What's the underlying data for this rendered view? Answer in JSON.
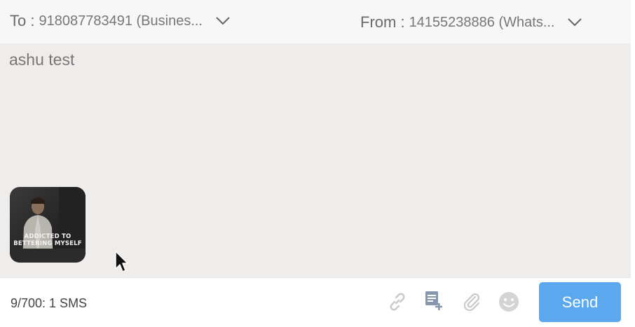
{
  "header": {
    "to_label": "To :",
    "to_value": "918087783491 (Busines...",
    "from_label": "From :",
    "from_value": "14155238886 (Whats..."
  },
  "message": {
    "text": "ashu test",
    "attachment_caption_line1": "ADDICTED TO",
    "attachment_caption_line2": "BETTERING MYSELF"
  },
  "footer": {
    "counter": "9/700: 1 SMS",
    "send_label": "Send"
  },
  "icons": {
    "to_dropdown": "chevron-down-icon",
    "from_dropdown": "chevron-down-icon",
    "link": "link-icon",
    "template": "template-add-icon",
    "attach": "paperclip-icon",
    "emoji": "emoji-icon",
    "cursor": "mouse-pointer-icon"
  },
  "colors": {
    "send_button": "#5ba8ef",
    "body_background": "#eeedec",
    "header_background": "#f7f7f7",
    "icon_disabled": "#c8c8c8",
    "icon_template": "#8a9ab0"
  }
}
